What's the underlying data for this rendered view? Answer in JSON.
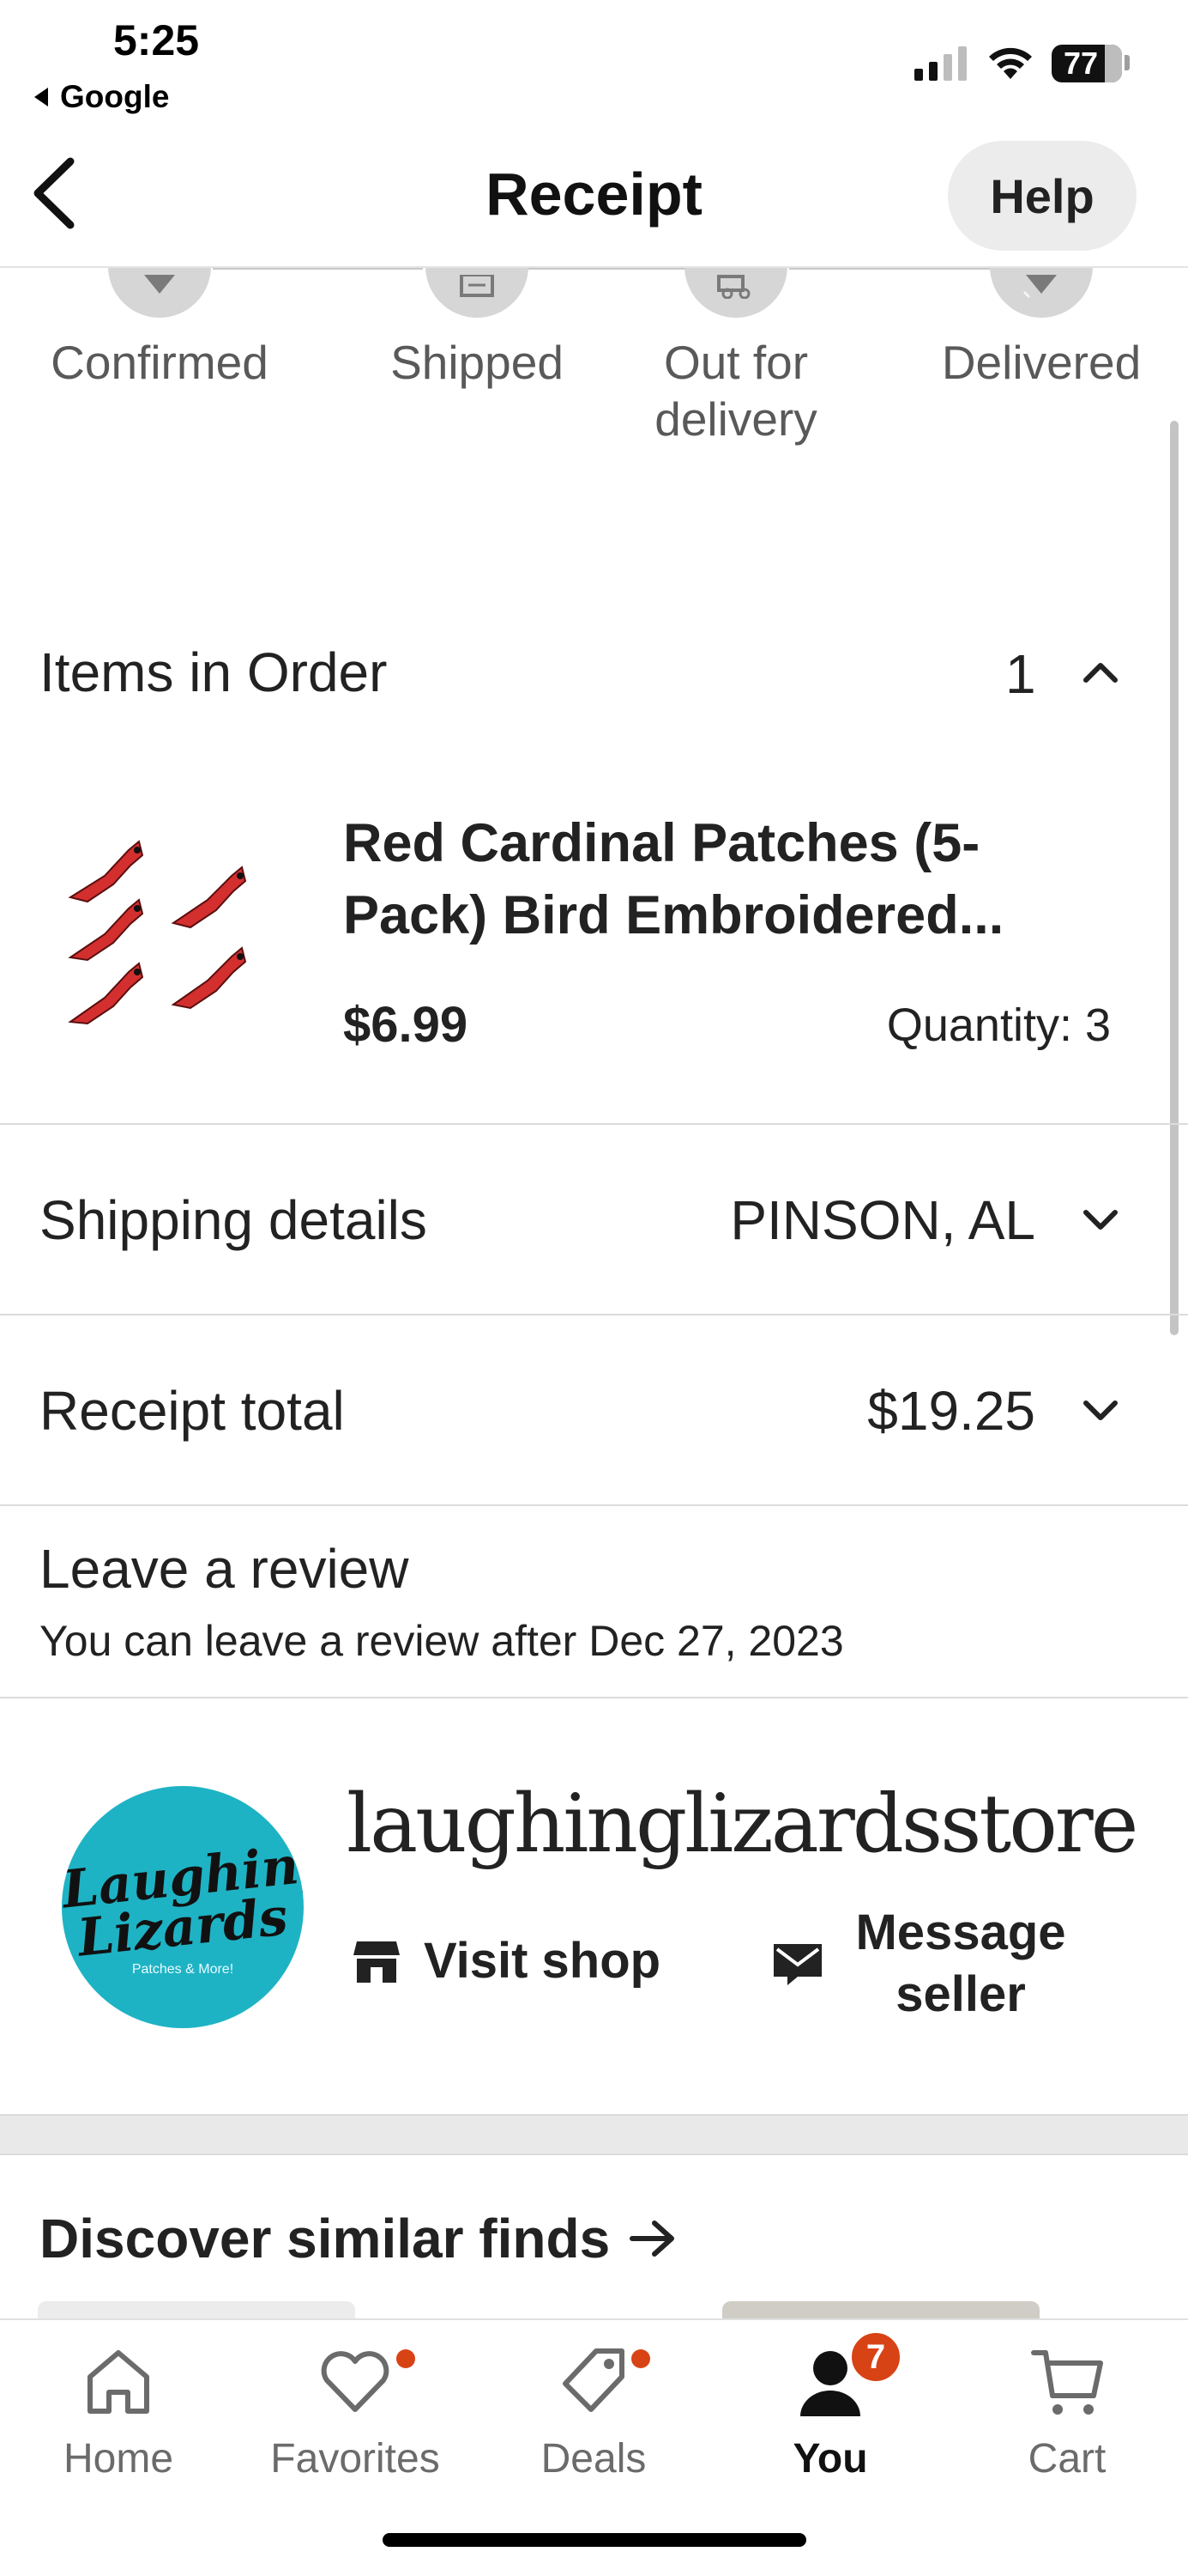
{
  "status_bar": {
    "time": "5:25",
    "back_app": "Google",
    "battery": "77"
  },
  "header": {
    "title": "Receipt",
    "help_label": "Help"
  },
  "tracker": {
    "steps": [
      {
        "label": "Confirmed"
      },
      {
        "label": "Shipped"
      },
      {
        "label": "Out for delivery"
      },
      {
        "label": "Delivered"
      }
    ]
  },
  "items": {
    "title": "Items in Order",
    "count": "1",
    "product": {
      "title": "Red Cardinal Patches (5-Pack) Bird Embroidered...",
      "price": "$6.99",
      "quantity": "Quantity: 3"
    }
  },
  "shipping": {
    "label": "Shipping details",
    "value": "PINSON, AL"
  },
  "total": {
    "label": "Receipt total",
    "value": "$19.25"
  },
  "review": {
    "title": "Leave a review",
    "subtitle": "You can leave a review after Dec 27, 2023"
  },
  "shop": {
    "name": "laughinglizardsstore",
    "logo_line1": "Laughing",
    "logo_line2": "Lizards",
    "logo_line3": "Patches & More!",
    "visit_label": "Visit shop",
    "message_label": "Message seller"
  },
  "discover": {
    "title": "Discover similar finds"
  },
  "tabbar": {
    "tabs": [
      {
        "label": "Home"
      },
      {
        "label": "Favorites"
      },
      {
        "label": "Deals"
      },
      {
        "label": "You",
        "badge": "7"
      },
      {
        "label": "Cart"
      }
    ]
  },
  "colors": {
    "accent": "#d84315",
    "logo_teal": "#1eb3c4",
    "cardinal_red": "#d32f2f"
  }
}
